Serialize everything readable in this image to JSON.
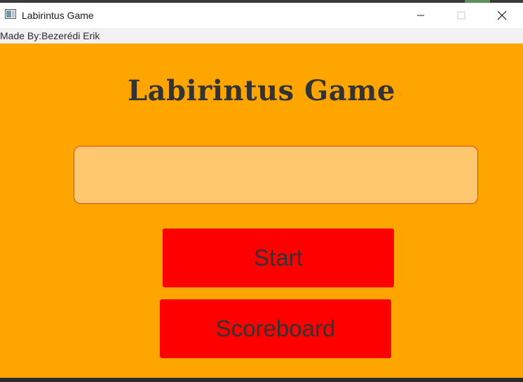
{
  "window": {
    "title": "Labirintus Game",
    "icon": "window-app-icon",
    "controls": [
      "minimize-icon",
      "maximize-icon",
      "close-icon"
    ]
  },
  "menubar": {
    "made_by": "Made By:Bezerédi Erik"
  },
  "main": {
    "title": "Labirintus Game",
    "name_input": {
      "value": "",
      "placeholder": ""
    },
    "start_label": "Start",
    "scoreboard_label": "Scoreboard"
  },
  "colors": {
    "background": "#ffa500",
    "input_fill": "#ffc870",
    "input_border": "#e8401c",
    "button": "#ff0000",
    "text": "#333333"
  }
}
